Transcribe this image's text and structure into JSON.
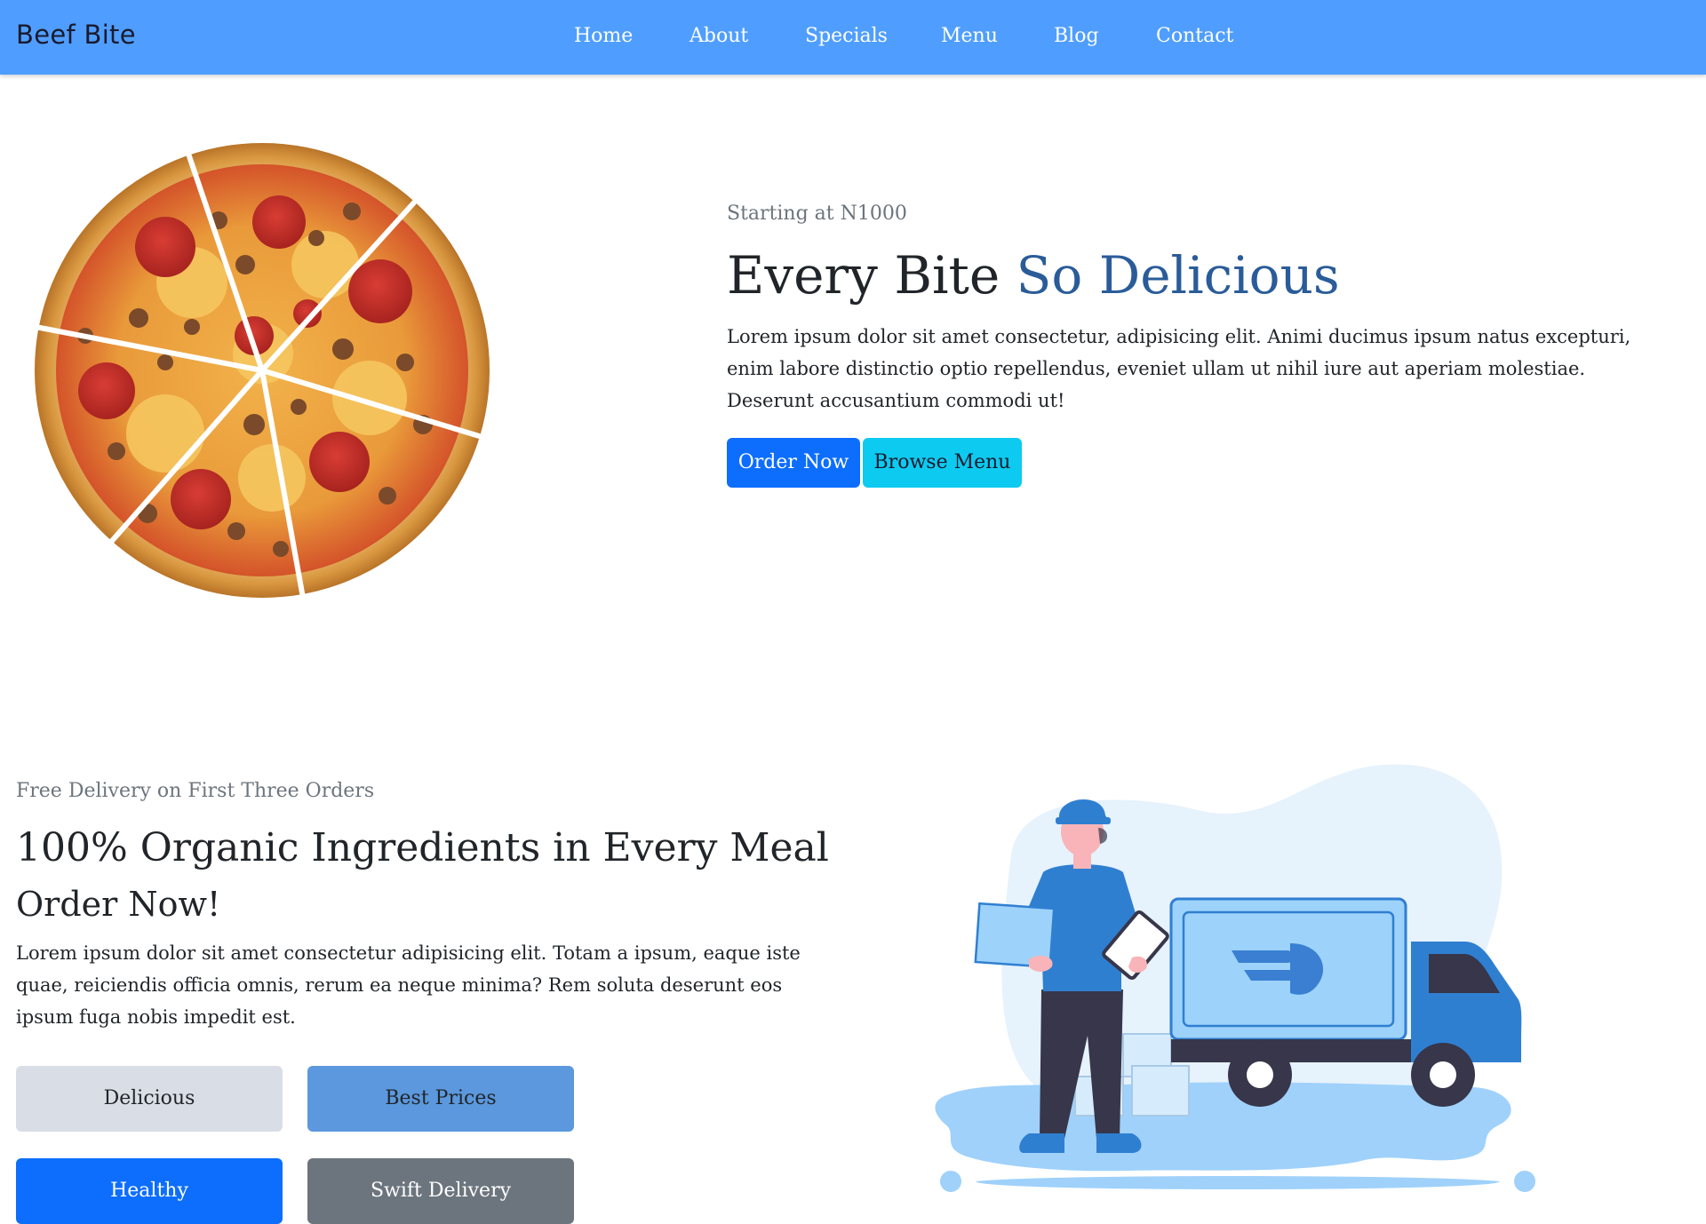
{
  "navbar": {
    "brand": "Beef Bite",
    "links": [
      "Home",
      "About",
      "Specials",
      "Menu",
      "Blog",
      "Contact"
    ]
  },
  "hero": {
    "kicker": "Starting at N1000",
    "title_plain": "Every Bite ",
    "title_accent": "So Delicious",
    "body": "Lorem ipsum dolor sit amet consectetur, adipisicing elit. Animi ducimus ipsum natus excepturi, enim labore distinctio optio repellendus, eveniet ullam ut nihil iure aut aperiam molestiae. Deserunt accusantium commodi ut!",
    "primary_button": "Order Now",
    "secondary_button": "Browse Menu"
  },
  "section2": {
    "kicker": "Free Delivery on First Three Orders",
    "title": "100% Organic Ingredients in Every Meal",
    "subtitle": "Order Now!",
    "body": "Lorem ipsum dolor sit amet consectetur adipisicing elit. Totam a ipsum, eaque iste quae, reiciendis officia omnis, rerum ea neque minima? Rem soluta deserunt eos ipsum fuga nobis impedit est.",
    "features": [
      "Delicious",
      "Best Prices",
      "Healthy",
      "Swift Delivery"
    ]
  },
  "colors": {
    "navbar": "#4f9eff",
    "accent": "#2a5c99",
    "primary": "#0d6efd",
    "info": "#0dcaf0"
  }
}
